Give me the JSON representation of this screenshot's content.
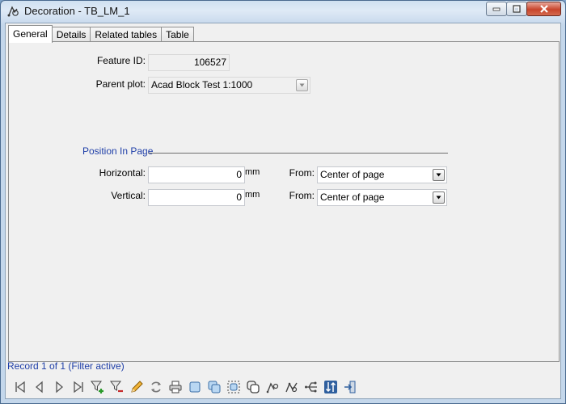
{
  "window": {
    "title": "Decoration - TB_LM_1"
  },
  "tabs": [
    {
      "label": "General",
      "active": true
    },
    {
      "label": "Details",
      "active": false
    },
    {
      "label": "Related tables",
      "active": false
    },
    {
      "label": "Table",
      "active": false
    }
  ],
  "general": {
    "feature_id_label": "Feature ID:",
    "feature_id_value": "106527",
    "parent_plot_label": "Parent plot:",
    "parent_plot_value": "Acad Block Test 1:1000",
    "section_title": "Position In Page",
    "horizontal_label": "Horizontal:",
    "horizontal_value": "0",
    "horizontal_unit": "mm",
    "horizontal_from_label": "From:",
    "horizontal_from_value": "Center of page",
    "vertical_label": "Vertical:",
    "vertical_value": "0",
    "vertical_unit": "mm",
    "vertical_from_label": "From:",
    "vertical_from_value": "Center of page"
  },
  "status": {
    "record_text": "Record 1 of 1 (Filter active)"
  },
  "toolbar_icons": [
    "first-record-icon",
    "previous-record-icon",
    "next-record-icon",
    "last-record-icon",
    "add-filter-icon",
    "remove-filter-icon",
    "edit-pencil-icon",
    "refresh-icon",
    "print-icon",
    "select-icon",
    "multi-select-icon",
    "dashed-select-icon",
    "copy-objects-icon",
    "undo-icon",
    "redo-icon",
    "network-icon",
    "sort-icon",
    "exit-icon"
  ],
  "colors": {
    "section_title": "#1f3fa8",
    "status_text": "#1f3fa8",
    "close_button": "#c8452c"
  }
}
